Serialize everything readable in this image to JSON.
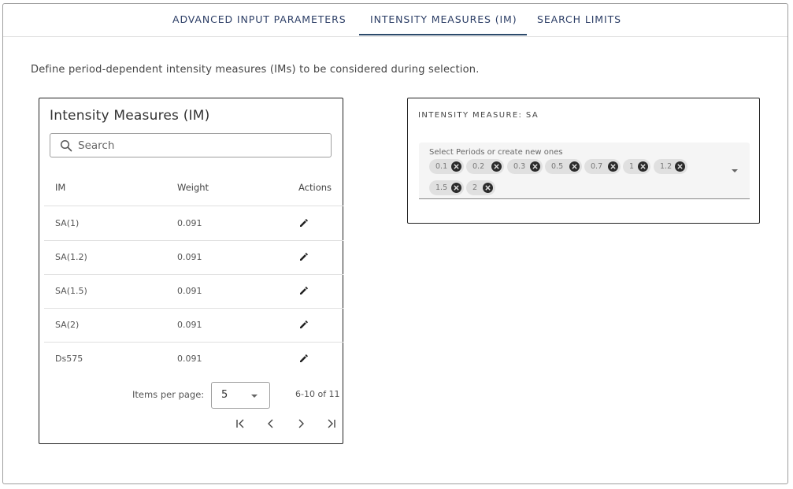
{
  "tabs": [
    {
      "label": "ADVANCED INPUT PARAMETERS"
    },
    {
      "label": "INTENSITY MEASURES (IM)"
    },
    {
      "label": "SEARCH LIMITS"
    }
  ],
  "active_tab": "INTENSITY MEASURES (IM)",
  "intro_text": "Define period-dependent intensity measures (IMs) to be considered during selection.",
  "im_table": {
    "title": "Intensity Measures (IM)",
    "search": {
      "placeholder": "Search",
      "value": "",
      "icon": "search-icon"
    },
    "columns": [
      "IM",
      "Weight",
      "Actions"
    ],
    "rows": [
      {
        "im": "SA(1)",
        "weight": "0.091",
        "action_icon": "edit-icon"
      },
      {
        "im": "SA(1.2)",
        "weight": "0.091",
        "action_icon": "edit-icon"
      },
      {
        "im": "SA(1.5)",
        "weight": "0.091",
        "action_icon": "edit-icon"
      },
      {
        "im": "SA(2)",
        "weight": "0.091",
        "action_icon": "edit-icon"
      },
      {
        "im": "Ds575",
        "weight": "0.091",
        "action_icon": "edit-icon"
      }
    ],
    "paginator": {
      "items_per_page_label": "Items per page:",
      "items_per_page": "5",
      "range_label": "6-10 of 11",
      "nav_icons": [
        "first-page-icon",
        "previous-page-icon",
        "next-page-icon",
        "last-page-icon"
      ]
    }
  },
  "sa_panel": {
    "title": "INTENSITY MEASURE: SA",
    "periods_label": "Select Periods or create new ones",
    "periods": [
      "0.1",
      "0.2",
      "0.3",
      "0.5",
      "0.7",
      "1",
      "1.2",
      "1.5",
      "2"
    ]
  },
  "colors": {
    "tab_text": "#2c3e66",
    "tab_indicator": "#2c4a6b",
    "chip_bg": "#e0e0e0",
    "chip_remove": "#2b2b2b",
    "field_bg": "#f5f5f5"
  }
}
